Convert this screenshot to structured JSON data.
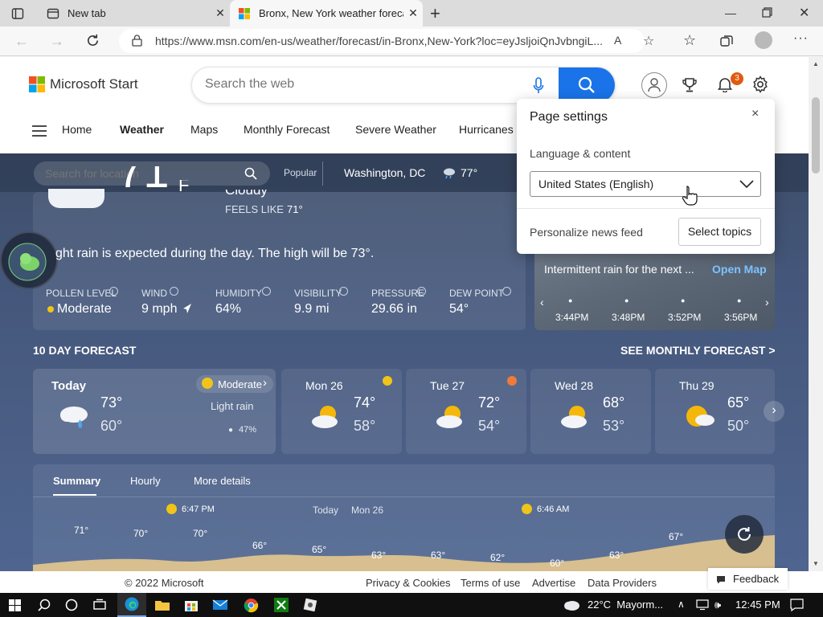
{
  "browser": {
    "tabs": [
      {
        "title": "New tab"
      },
      {
        "title": "Bronx, New York weather forecas"
      }
    ],
    "url": "https://www.msn.com/en-us/weather/forecast/in-Bronx,New-York?loc=eyJsljoiQnJvbngiL...",
    "new_tab_symbol": "+"
  },
  "site": {
    "brand": "Microsoft Start",
    "search_placeholder": "Search the web",
    "notification_count": "3",
    "nav": [
      "Home",
      "Weather",
      "Maps",
      "Monthly Forecast",
      "Severe Weather",
      "Hurricanes"
    ]
  },
  "location_bar": {
    "placeholder": "Search for location",
    "popular_label": "Popular",
    "popular_city": "Washington, DC",
    "popular_temp": "77°"
  },
  "current": {
    "temp_partial": "71",
    "unit_partial": "F",
    "condition_partial": "Cloudy",
    "feels_like_label": "FEELS LIKE",
    "feels_like": "71°",
    "summary": "ght rain is expected during the day. The high will be 73°.",
    "details": [
      {
        "label": "POLLEN LEVEL",
        "value": "Moderate"
      },
      {
        "label": "WIND",
        "value": "9 mph"
      },
      {
        "label": "HUMIDITY",
        "value": "64%"
      },
      {
        "label": "VISIBILITY",
        "value": "9.9 mi"
      },
      {
        "label": "PRESSURE",
        "value": "29.66 in"
      },
      {
        "label": "DEW POINT",
        "value": "54°"
      }
    ]
  },
  "map": {
    "message": "Intermittent rain for the next ...",
    "open_map": "Open Map",
    "times": [
      "3:44PM",
      "3:48PM",
      "3:52PM",
      "3:56PM"
    ]
  },
  "forecast": {
    "title": "10 DAY FORECAST",
    "monthly_link": "SEE MONTHLY FORECAST >",
    "today": {
      "label": "Today",
      "high": "73°",
      "low": "60°",
      "pollen": "Moderate",
      "condition": "Light rain",
      "precip": "47%"
    },
    "days": [
      {
        "label": "Mon 26",
        "high": "74°",
        "low": "58°"
      },
      {
        "label": "Tue 27",
        "high": "72°",
        "low": "54°"
      },
      {
        "label": "Wed 28",
        "high": "68°",
        "low": "53°"
      },
      {
        "label": "Thu 29",
        "high": "65°",
        "low": "50°"
      }
    ]
  },
  "detail_tabs": [
    "Summary",
    "Hourly",
    "More details"
  ],
  "hourly_chart": {
    "sunset": "6:47 PM",
    "sunrise": "6:46 AM",
    "today_label": "Today",
    "mon_label": "Mon 26",
    "temps": [
      "71°",
      "70°",
      "70°",
      "66°",
      "65°",
      "63°",
      "63°",
      "62°",
      "60°",
      "63°",
      "67°"
    ]
  },
  "settings_panel": {
    "title": "Page settings",
    "close": "×",
    "section_label": "Language & content",
    "language": "United States (English)",
    "personalize_label": "Personalize news feed",
    "select_topics": "Select topics"
  },
  "footer": {
    "copyright": "© 2022 Microsoft",
    "links": [
      "Privacy & Cookies",
      "Terms of use",
      "Advertise",
      "Data Providers"
    ],
    "feedback": "Feedback"
  },
  "taskbar": {
    "weather": "22°C  Mayorm...",
    "time": "12:45 PM"
  },
  "colors": {
    "accent": "#1a73e8",
    "notification": "#e05a12",
    "taskbar": "#101010"
  }
}
